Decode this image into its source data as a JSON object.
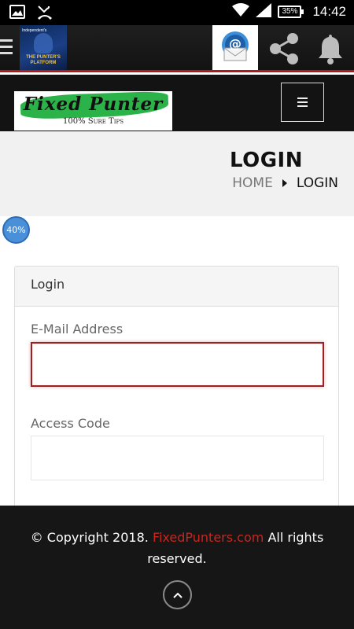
{
  "status_bar": {
    "battery": "35%",
    "time": "14:42",
    "icons": [
      "image-icon",
      "missed-call-icon",
      "wifi-icon",
      "signal-icon",
      "battery-icon"
    ]
  },
  "app_bar": {
    "logo_top_text": "Independent's",
    "logo_title": "THE PUNTER'S PLATFORM",
    "icons": [
      "menu-icon",
      "email-icon",
      "share-icon",
      "bell-icon"
    ]
  },
  "site_header": {
    "logo_title": "Fixed Punter",
    "logo_tagline": "100% Sure Tips",
    "brand_color": "#2bb34a"
  },
  "page": {
    "title": "LOGIN",
    "breadcrumb": {
      "home": "HOME",
      "current": "LOGIN"
    }
  },
  "progress_badge": "40%",
  "login_card": {
    "header": "Login",
    "email_label": "E-Mail Address",
    "email_value": "",
    "access_label": "Access Code",
    "access_value": ""
  },
  "footer": {
    "copyright_prefix": "© Copyright 2018.",
    "site_link": "FixedPunters.com",
    "copyright_suffix": "All rights reserved.",
    "link_color": "#c8261f"
  },
  "colors": {
    "accent_red": "#b31b1b",
    "focus_border": "#a11f1f",
    "progress_blue": "#4a90d9"
  }
}
